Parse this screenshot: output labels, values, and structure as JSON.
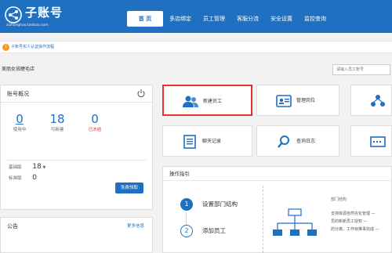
{
  "header": {
    "brand_title": "子账号",
    "brand_subtitle": "zizhanghao.taobao.com",
    "nav": [
      {
        "label": "首 页",
        "active": true
      },
      {
        "label": "多店绑定",
        "active": false
      },
      {
        "label": "员工管理",
        "active": false
      },
      {
        "label": "客服分流",
        "active": false
      },
      {
        "label": "安全设置",
        "active": false
      },
      {
        "label": "监控查询",
        "active": false
      }
    ]
  },
  "notice": {
    "text": "子账号实人认证操作流程"
  },
  "shop": {
    "name": "美丽女孩睫毛店",
    "search_placeholder": "请输入员工账号"
  },
  "account": {
    "title": "账号概况",
    "stats": [
      {
        "value": "0",
        "label": "使用中"
      },
      {
        "value": "18",
        "label": "可新建"
      },
      {
        "value": "0",
        "label": "已冻结"
      }
    ],
    "base_label": "基础版",
    "base_value": "18",
    "std_label": "标准版",
    "std_value": "0",
    "buy_button": "免费领取"
  },
  "announcement": {
    "title": "公告",
    "more": "更多信息"
  },
  "tiles": [
    {
      "label": "新建员工",
      "icon": "users-icon",
      "selected": true
    },
    {
      "label": "管理岗位",
      "icon": "id-card-icon",
      "selected": false
    },
    {
      "label": "",
      "icon": "org-icon",
      "selected": false
    },
    {
      "label": "聊天记录",
      "icon": "document-icon",
      "selected": false
    },
    {
      "label": "查询日志",
      "icon": "magnifier-icon",
      "selected": false
    },
    {
      "label": "",
      "icon": "terminal-icon",
      "selected": false
    }
  ],
  "guide": {
    "title": "操作指引",
    "steps": [
      {
        "num": "1",
        "label": "设置部门结构"
      },
      {
        "num": "2",
        "label": "添加员工"
      }
    ],
    "org_title": "部门结构",
    "org_lines": [
      "支持库源自然完化管理 —",
      "员的新新员工授权 —",
      "的分离，工作目推事完成 —"
    ]
  },
  "colors": {
    "primary": "#1f70c1",
    "alert": "#e33232",
    "notice": "#f39a2a"
  }
}
